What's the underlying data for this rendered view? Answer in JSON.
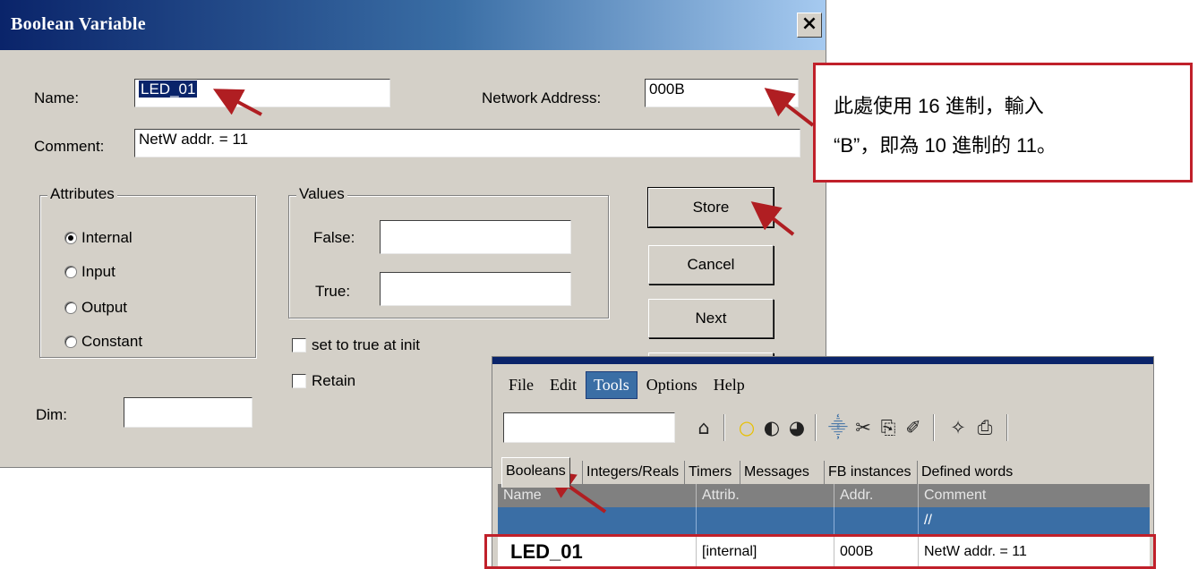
{
  "dialog": {
    "title": "Boolean Variable",
    "close_glyph": "×",
    "name_label": "Name:",
    "name_value": "LED_01",
    "network_label": "Network Address:",
    "network_value": "000B",
    "comment_label": "Comment:",
    "comment_value": "NetW addr. = 11",
    "attributes": {
      "legend": "Attributes",
      "options": [
        {
          "label": "Internal",
          "selected": true
        },
        {
          "label": "Input",
          "selected": false
        },
        {
          "label": "Output",
          "selected": false
        },
        {
          "label": "Constant",
          "selected": false
        }
      ]
    },
    "values": {
      "legend": "Values",
      "false_label": "False:",
      "false_value": "",
      "true_label": "True:",
      "true_value": ""
    },
    "checkboxes": [
      {
        "label": "set to true at init",
        "checked": false
      },
      {
        "label": "Retain",
        "checked": false
      }
    ],
    "dim_label": "Dim:",
    "dim_value": "",
    "buttons": {
      "store": "Store",
      "cancel": "Cancel",
      "next": "Next"
    }
  },
  "callout": {
    "line1": "此處使用 16 進制，輸入",
    "line2": "“B”，即為 10 進制的 11。"
  },
  "dictionary": {
    "menu": [
      "File",
      "Edit",
      "Tools",
      "Options",
      "Help"
    ],
    "active_menu": "Tools",
    "toolbar_icons": [
      "open-icon",
      "circle-yellow-icon",
      "half-circle-icon",
      "clock-icon",
      "split-icon",
      "cut-icon",
      "copy-icon",
      "paste-icon",
      "wand-icon",
      "print-icon"
    ],
    "tabs": [
      "Booleans",
      "Integers/Reals",
      "Timers",
      "Messages",
      "FB instances",
      "Defined words"
    ],
    "active_tab": "Booleans",
    "columns": [
      "Name",
      "Attrib.",
      "Addr.",
      "Comment"
    ],
    "selected_row": {
      "name": "",
      "attrib": "",
      "addr": "",
      "comment": "//"
    },
    "rows": [
      {
        "name": "LED_01",
        "attrib": "[internal]",
        "addr": "000B",
        "comment": "NetW addr. = 11"
      }
    ]
  },
  "colors": {
    "arrow": "#b01e22",
    "highlight": "#c0202a",
    "title_bar": "#0a246a"
  }
}
